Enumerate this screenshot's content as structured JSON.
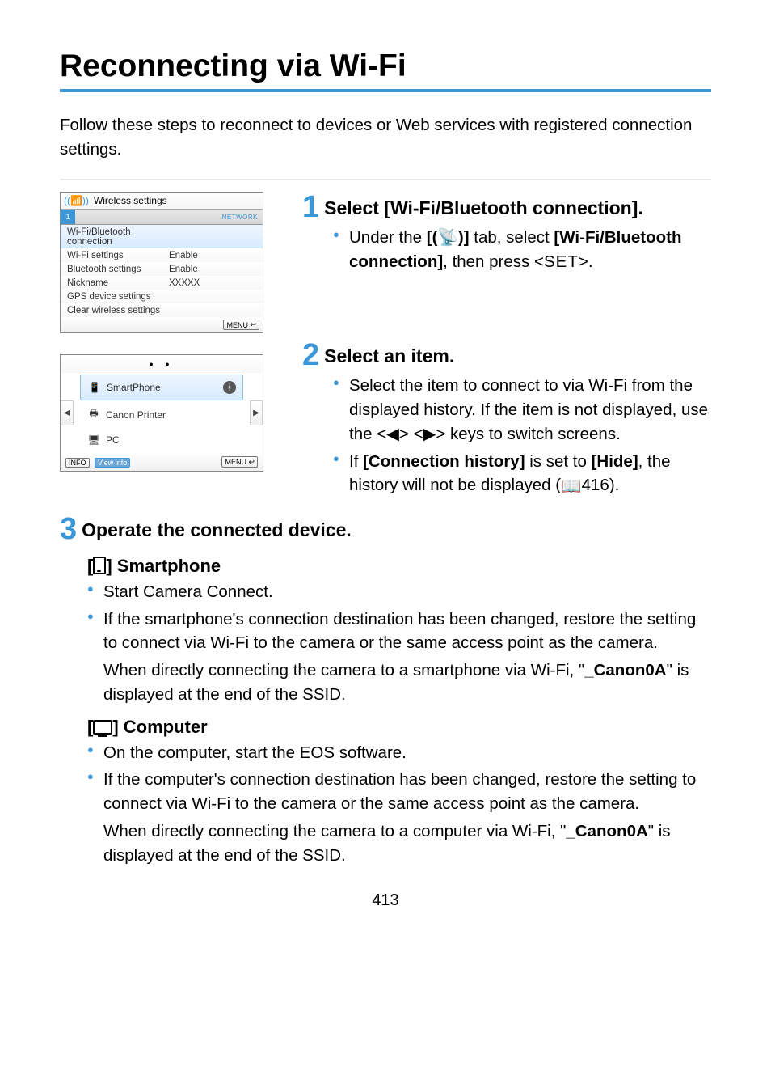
{
  "title": "Reconnecting via Wi-Fi",
  "intro": "Follow these steps to reconnect to devices or Web services with registered connection settings.",
  "shot1": {
    "title": "Wireless settings",
    "tab": "1",
    "network_label": "NETWORK",
    "rows": [
      {
        "label": "Wi-Fi/Bluetooth connection",
        "value": ""
      },
      {
        "label": "Wi-Fi settings",
        "value": "Enable"
      },
      {
        "label": "Bluetooth settings",
        "value": "Enable"
      },
      {
        "label": "Nickname",
        "value": "XXXXX"
      },
      {
        "label": "GPS device settings",
        "value": ""
      },
      {
        "label": "Clear wireless settings",
        "value": ""
      }
    ],
    "menu": "MENU"
  },
  "shot2": {
    "items": [
      {
        "icon": "📱",
        "label": "SmartPhone",
        "bt": true
      },
      {
        "icon": "🖶",
        "label": "Canon Printer",
        "bt": false
      },
      {
        "icon": "🖥",
        "label": "PC",
        "bt": false
      }
    ],
    "info": "INFO",
    "view": "View info",
    "menu": "MENU"
  },
  "step1": {
    "title": "Select [Wi-Fi/Bluetooth connection].",
    "b1a": "Under the ",
    "b1b": " tab, select ",
    "b1c": "[Wi-Fi/Bluetooth connection]",
    "b1d": ", then press <",
    "b1e": ">."
  },
  "step2": {
    "title": "Select an item.",
    "b1": "Select the item to connect to via Wi-Fi from the displayed history. If the item is not displayed, use the <◀> <▶> keys to switch screens.",
    "b2a": "If ",
    "b2b": "[Connection history]",
    "b2c": " is set to ",
    "b2d": "[Hide]",
    "b2e": ", the history will not be displayed (",
    "b2f": "416)."
  },
  "step3": {
    "title": "Operate the connected device.",
    "sp": {
      "heading": "Smartphone",
      "b1": "Start Camera Connect.",
      "b2": "If the smartphone's connection destination has been changed, restore the setting to connect via Wi-Fi to the camera or the same access point as the camera.",
      "note_a": "When directly connecting the camera to a smartphone via Wi-Fi, \"",
      "note_b": "_Canon0A",
      "note_c": "\" is displayed at the end of the SSID."
    },
    "pc": {
      "heading": "Computer",
      "b1": "On the computer, start the EOS software.",
      "b2": "If the computer's connection destination has been changed, restore the setting to connect via Wi-Fi to the camera or the same access point as the camera.",
      "note_a": "When directly connecting the camera to a computer via Wi-Fi, \"",
      "note_b": "_Canon0A",
      "note_c": "\" is displayed at the end of the SSID."
    }
  },
  "set_key": "SET",
  "wifi_bracket_a": "[",
  "wifi_bracket_b": "]",
  "page_num": "413"
}
